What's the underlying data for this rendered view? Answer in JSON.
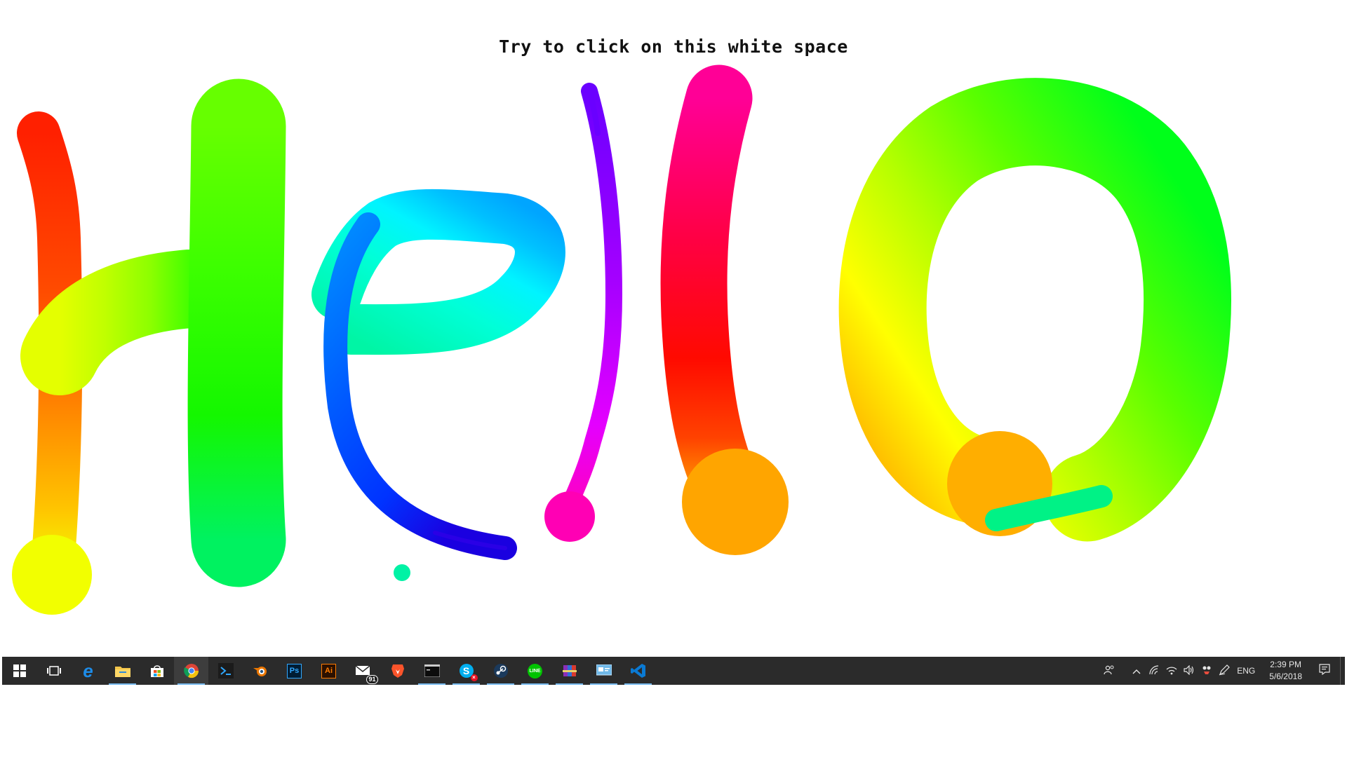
{
  "page": {
    "instruction": "Try to click on this white space"
  },
  "drawing": {
    "word": "Hello",
    "strokes": [
      {
        "letter": "H",
        "part": "left-vertical",
        "colors": [
          "#ff2000",
          "#ff4a00",
          "#ff7f00",
          "#ffc400",
          "#f2ff00"
        ]
      },
      {
        "letter": "H",
        "part": "crossbar",
        "colors": [
          "#e4ff00",
          "#c0ff00",
          "#8cff00",
          "#44ff00"
        ]
      },
      {
        "letter": "H",
        "part": "right-vertical",
        "colors": [
          "#66ff00",
          "#3cff00",
          "#14f700",
          "#00f260"
        ]
      },
      {
        "letter": "e",
        "part": "loop",
        "colors": [
          "#00f5a5",
          "#00ffe0",
          "#00e4ff",
          "#00a5ff"
        ]
      },
      {
        "letter": "e",
        "part": "tail",
        "colors": [
          "#0090ff",
          "#005cff",
          "#0033ff",
          "#1a00e0"
        ]
      },
      {
        "letter": "e",
        "part": "dot",
        "colors": [
          "#00f2a5"
        ]
      },
      {
        "letter": "l",
        "part": "thin-stroke",
        "colors": [
          "#6a00ff",
          "#a400ff",
          "#e400ff",
          "#ff00c0"
        ]
      },
      {
        "letter": "l",
        "part": "thick-stroke",
        "colors": [
          "#ff0096",
          "#ff0044",
          "#ff0a00",
          "#ff4200",
          "#ffa500"
        ]
      },
      {
        "letter": "o",
        "part": "ring",
        "colors": [
          "#00ff1a",
          "#5aff00",
          "#b4ff00",
          "#ffff00",
          "#ffb000"
        ]
      },
      {
        "letter": "o",
        "part": "tail",
        "colors": [
          "#00f286"
        ]
      }
    ]
  },
  "taskbar": {
    "apps": [
      {
        "name": "start-button",
        "icon": "windows-logo-icon",
        "label": "Start",
        "state": "none"
      },
      {
        "name": "task-view-button",
        "icon": "task-view-icon",
        "label": "Task View",
        "state": "none"
      },
      {
        "name": "edge-button",
        "icon": "edge-icon",
        "label": "e",
        "state": "none"
      },
      {
        "name": "file-explorer-button",
        "icon": "folder-icon",
        "label": "File Explorer",
        "state": "running"
      },
      {
        "name": "store-button",
        "icon": "store-icon",
        "label": "Store",
        "state": "none"
      },
      {
        "name": "chrome-button",
        "icon": "chrome-icon",
        "label": "Google Chrome",
        "state": "active"
      },
      {
        "name": "terminal-app-button",
        "icon": "prompt-icon",
        "label": "Terminal",
        "state": "none"
      },
      {
        "name": "blender-button",
        "icon": "blender-icon",
        "label": "Blender",
        "state": "none"
      },
      {
        "name": "photoshop-button",
        "icon": "photoshop-icon",
        "label": "Ps",
        "state": "none"
      },
      {
        "name": "illustrator-button",
        "icon": "illustrator-icon",
        "label": "Ai",
        "state": "none"
      },
      {
        "name": "mail-button",
        "icon": "mail-icon",
        "label": "Mail",
        "badge": "91",
        "state": "none"
      },
      {
        "name": "brave-button",
        "icon": "brave-lion-icon",
        "label": "Brave",
        "state": "none"
      },
      {
        "name": "console-button",
        "icon": "console-icon",
        "label": "Console",
        "state": "running"
      },
      {
        "name": "skype-button",
        "icon": "skype-icon",
        "label": "S",
        "state": "running"
      },
      {
        "name": "steam-button",
        "icon": "steam-icon",
        "label": "Steam",
        "state": "running"
      },
      {
        "name": "line-button",
        "icon": "line-icon",
        "label": "LINE",
        "state": "running"
      },
      {
        "name": "winrar-button",
        "icon": "winrar-icon",
        "label": "WinRAR",
        "state": "running"
      },
      {
        "name": "control-panel-button",
        "icon": "control-panel-icon",
        "label": "Control Panel",
        "state": "running"
      },
      {
        "name": "vscode-button",
        "icon": "vscode-icon",
        "label": "Visual Studio Code",
        "state": "running"
      }
    ],
    "tray": {
      "people_icon": "people-icon",
      "overflow_icon": "chevron-up-icon",
      "network_icon": "network-icon",
      "wifi_icon": "wifi-icon",
      "volume_icon": "speaker-icon",
      "app_icon_1": "app-tray-icon",
      "pen_icon": "pen-icon",
      "language": "ENG",
      "time": "2:39 PM",
      "date": "5/6/2018",
      "notification_icon": "action-center-icon"
    },
    "colors": {
      "background": "#2b2b2b",
      "active_background": "#3d3d3d",
      "running_indicator": "#76b9ed"
    }
  }
}
